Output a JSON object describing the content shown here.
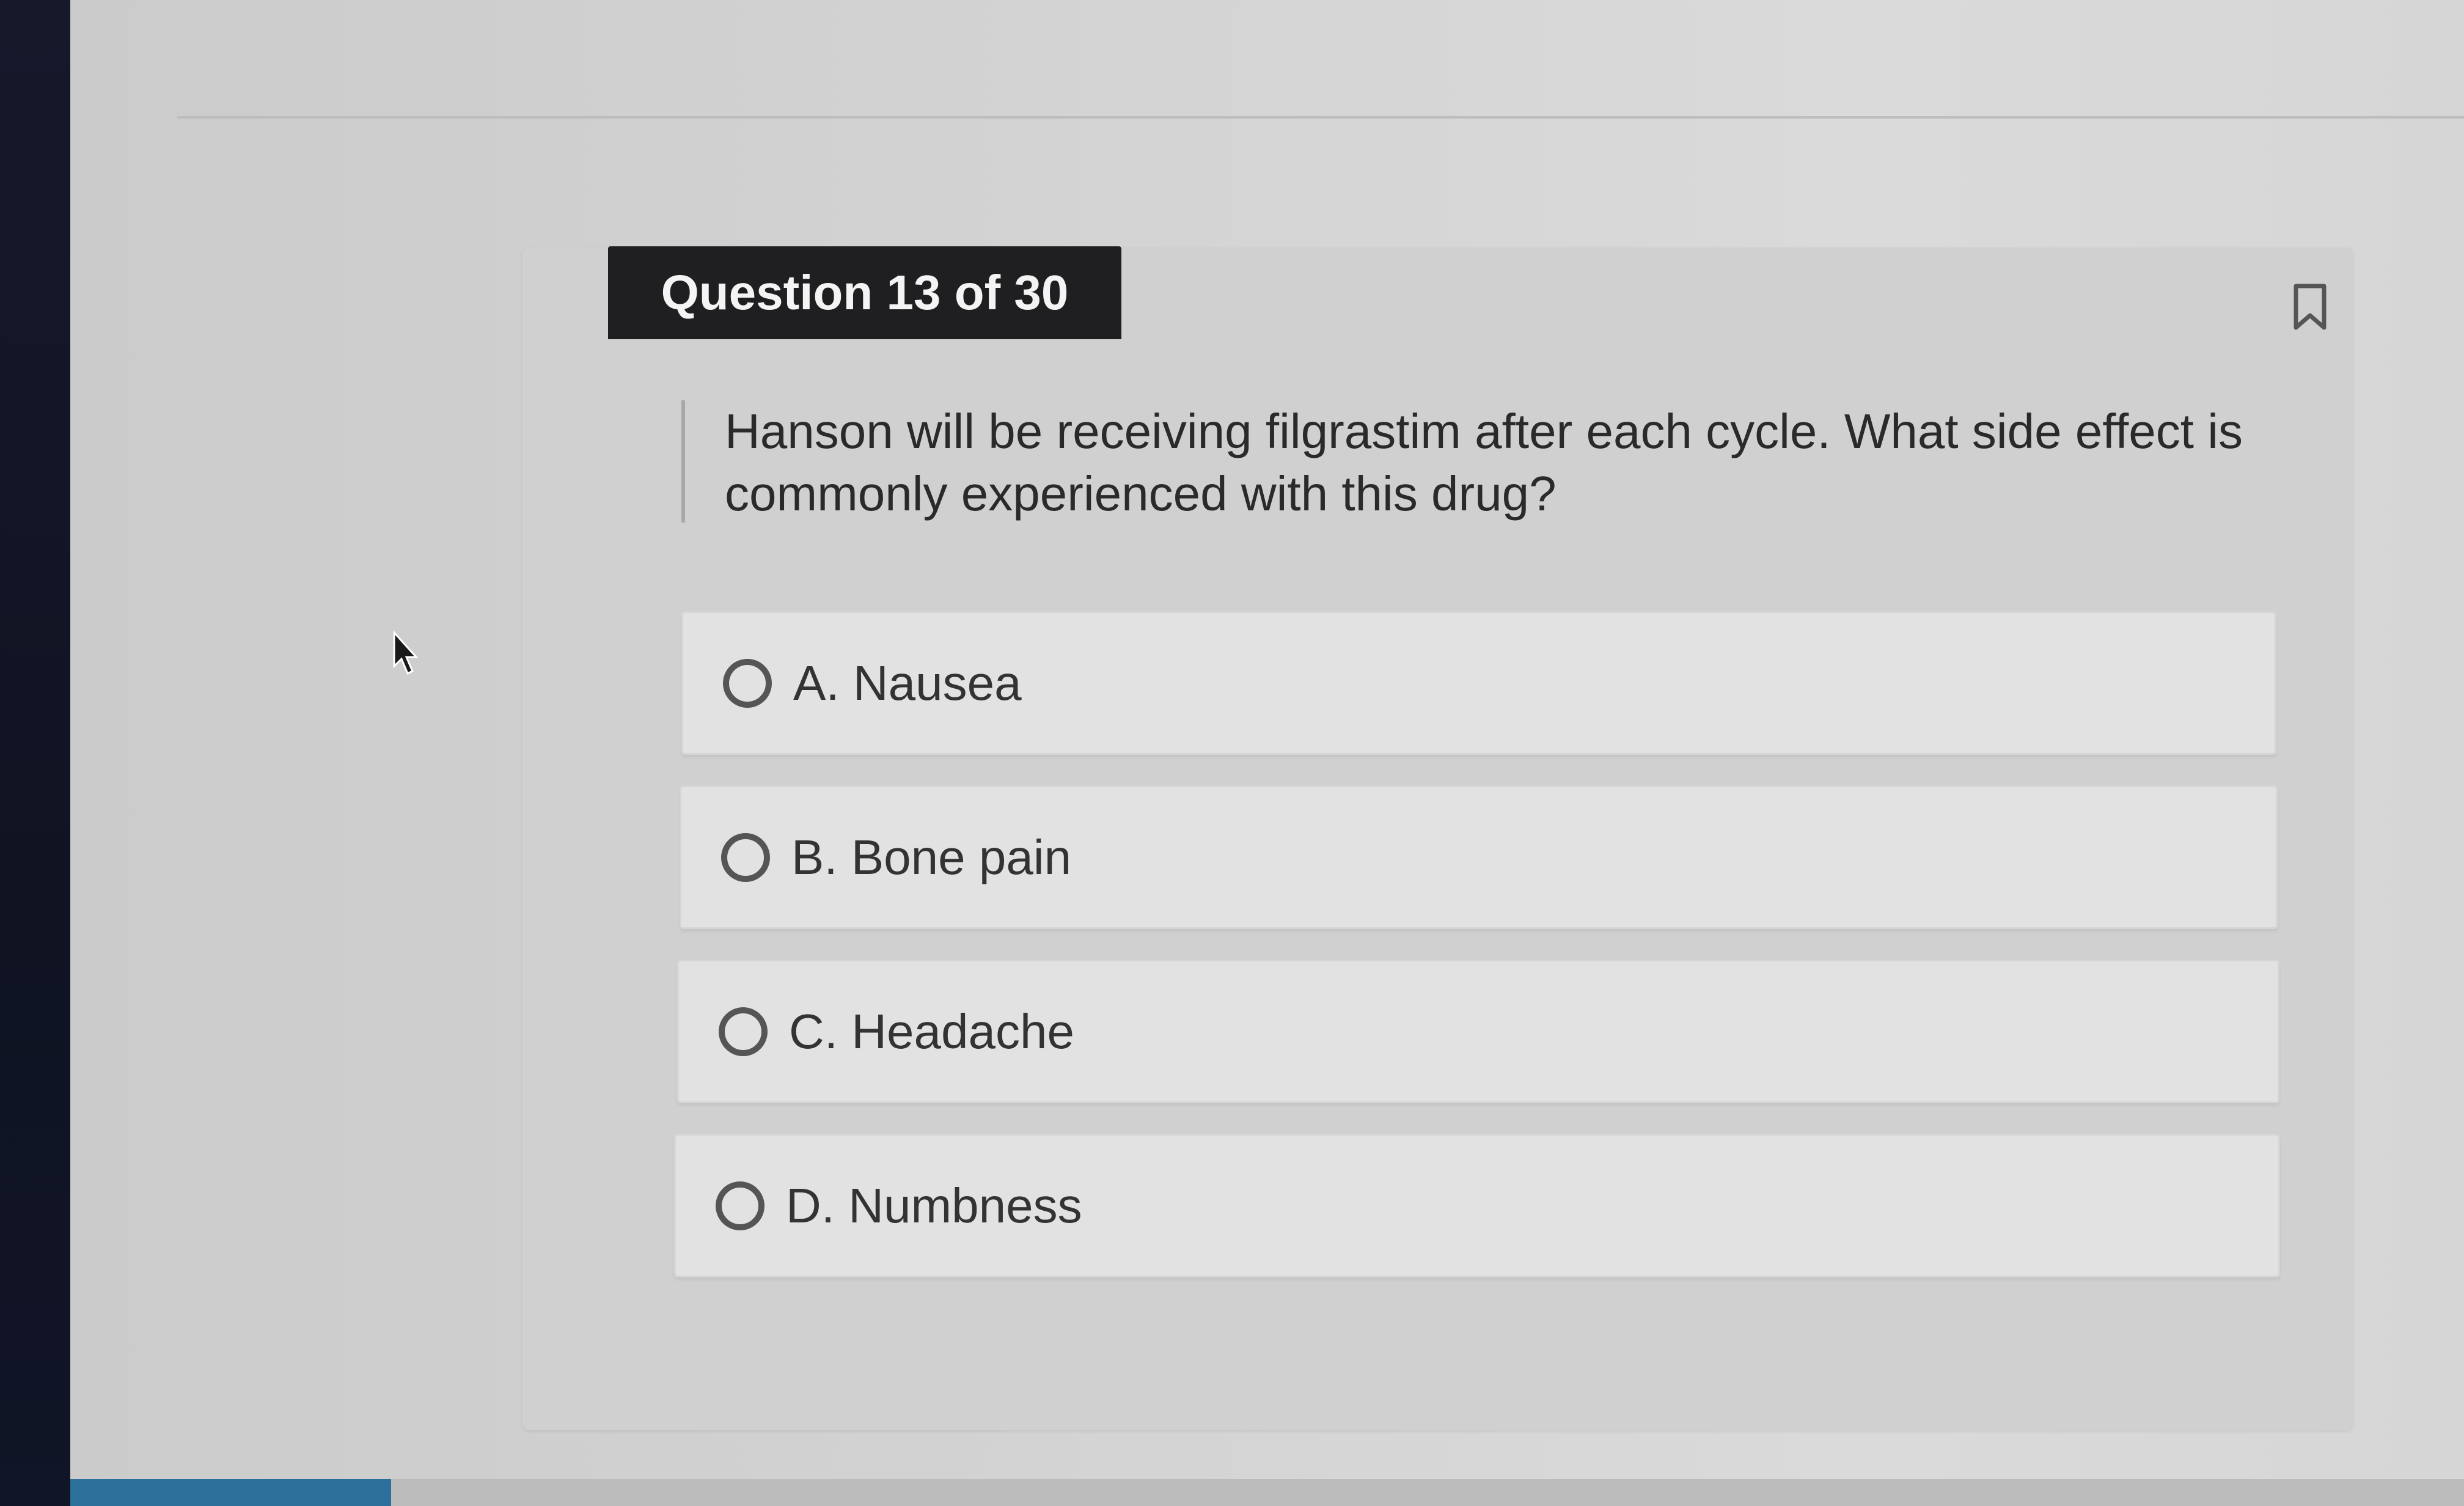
{
  "question": {
    "counter": "Question 13 of 30",
    "stem": "Hanson will be receiving filgrastim after each cycle. What side effect is commonly experienced with this drug?",
    "options": [
      {
        "label": "A. Nausea"
      },
      {
        "label": "B. Bone pain"
      },
      {
        "label": "C. Headache"
      },
      {
        "label": "D. Numbness"
      }
    ]
  },
  "icons": {
    "bookmark": "bookmark-icon",
    "cursor": "mouse-cursor-icon",
    "radio": "radio-button-unselected"
  },
  "colors": {
    "tab_background": "#1f1f21",
    "tab_text": "#f4f4f4",
    "card_background": "#d0d0d0",
    "option_background": "#e2e2e2",
    "radio_border": "#555555",
    "text": "#333333",
    "accent_bar": "#2c6f9b"
  }
}
